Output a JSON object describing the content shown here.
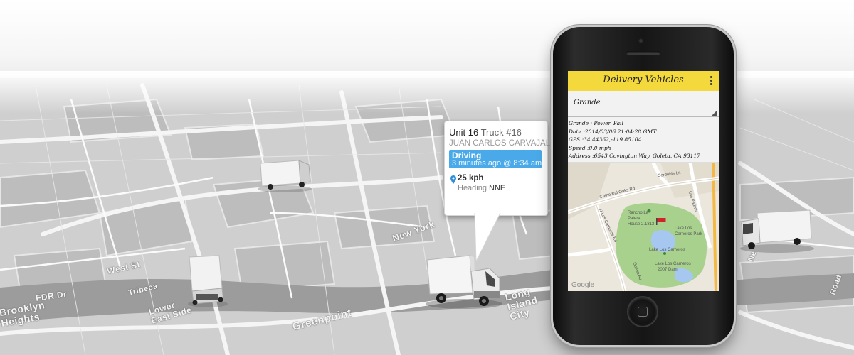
{
  "map_labels": {
    "new_york": "New York",
    "west_st": "West St",
    "fdr_dr": "FDR Dr",
    "tribeca": "Tribeca",
    "lower_east_side": "Lower East Side",
    "brooklyn_heights": "Brooklyn Heights",
    "greenpoint": "Greenpoint",
    "long_island_city": "Long Island City",
    "partial_ne": "Ne",
    "partial_road": "Road"
  },
  "bubble": {
    "unit": "Unit 16",
    "truck": "Truck #16",
    "driver": "JUAN CARLOS CARVAJAL",
    "status": "Driving",
    "time": "3 minutes ago @ 8:34 am",
    "speed": "25 kph",
    "heading_label": "Heading",
    "heading_value": "NNE"
  },
  "phone": {
    "app_title": "Delivery Vehicles",
    "spinner_value": "Grande",
    "details": [
      {
        "key": "Grande",
        "sep": " : ",
        "value": "Power_Fail"
      },
      {
        "key": "Date",
        "sep": " :",
        "value": "2014/03/06 21:04:28 GMT"
      },
      {
        "key": "GPS",
        "sep": " :",
        "value": "34.44362,-119.85104"
      },
      {
        "key": "Speed",
        "sep": " :",
        "value": "0.0 mph"
      },
      {
        "key": "Address",
        "sep": " :",
        "value": "6543 Covington Way, Goleta, CA 93117"
      }
    ],
    "mini_map": {
      "labels": {
        "cathedral_oaks": "Cathedral Oaks Rd",
        "cordoble": "Cordoble Ln",
        "los_carneros_rd": "N Los Carneros Rd",
        "los_carneros_rd2": "Los Carneros Rd",
        "rancho1": "Rancho La",
        "rancho2": "Patera",
        "rancho3": "House 2.1813",
        "lake_park1": "Lake Los",
        "lake_park2": "Carneros Park",
        "lake": "Lake Los Carneros",
        "dam1": "Lake Los Carneros",
        "dam2": "2007 Dam",
        "goleta": "Goleta Av",
        "side_road": "Los Padres"
      },
      "google": "Google"
    }
  },
  "colors": {
    "app_bar": "#f3d93c",
    "status_blue": "#4aa9e8",
    "park_green": "#a9d18e",
    "water_blue": "#a6c8f0",
    "pin_red": "#d2232a"
  },
  "icons": [
    "overflow-menu-icon",
    "spinner-dropdown-icon",
    "location-pin-icon",
    "map-flag-icon",
    "map-marker-icon"
  ]
}
